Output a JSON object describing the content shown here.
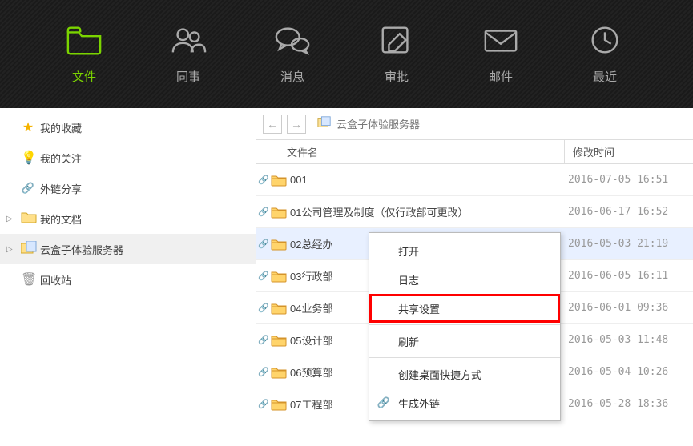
{
  "nav": [
    {
      "label": "文件",
      "icon": "folder"
    },
    {
      "label": "同事",
      "icon": "people"
    },
    {
      "label": "消息",
      "icon": "chat"
    },
    {
      "label": "审批",
      "icon": "edit"
    },
    {
      "label": "邮件",
      "icon": "mail"
    },
    {
      "label": "最近",
      "icon": "clock"
    }
  ],
  "nav_active": 0,
  "sidebar": [
    {
      "label": "我的收藏",
      "icon": "star",
      "expander": ""
    },
    {
      "label": "我的关注",
      "icon": "bulb",
      "expander": ""
    },
    {
      "label": "外链分享",
      "icon": "link",
      "expander": ""
    },
    {
      "label": "我的文档",
      "icon": "folder-yellow",
      "expander": "▷"
    },
    {
      "label": "云盒子体验服务器",
      "icon": "folder-doc",
      "expander": "▷",
      "selected": true
    },
    {
      "label": "回收站",
      "icon": "trash",
      "expander": ""
    }
  ],
  "breadcrumb": {
    "title": "云盒子体验服务器"
  },
  "list_header": {
    "name": "文件名",
    "time": "修改时间"
  },
  "files": [
    {
      "name": "001",
      "time": "2016-07-05 16:51",
      "link": true
    },
    {
      "name": "01公司管理及制度（仅行政部可更改）",
      "time": "2016-06-17 16:52",
      "link": true
    },
    {
      "name": "02总经办",
      "time": "2016-05-03 21:19",
      "link": true,
      "selected": true
    },
    {
      "name": "03行政部",
      "time": "2016-06-05 16:11",
      "link": true
    },
    {
      "name": "04业务部",
      "time": "2016-06-01 09:36",
      "link": true
    },
    {
      "name": "05设计部",
      "time": "2016-05-03 11:48",
      "link": true
    },
    {
      "name": "06预算部",
      "time": "2016-05-04 10:26",
      "link": true
    },
    {
      "name": "07工程部",
      "time": "2016-05-28 18:36",
      "link": true
    }
  ],
  "context_menu": [
    {
      "label": "打开"
    },
    {
      "label": "日志"
    },
    {
      "label": "共享设置",
      "highlight": true
    },
    {
      "sep": true
    },
    {
      "label": "刷新"
    },
    {
      "sep": true
    },
    {
      "label": "创建桌面快捷方式"
    },
    {
      "label": "生成外链",
      "icon": "link"
    }
  ]
}
